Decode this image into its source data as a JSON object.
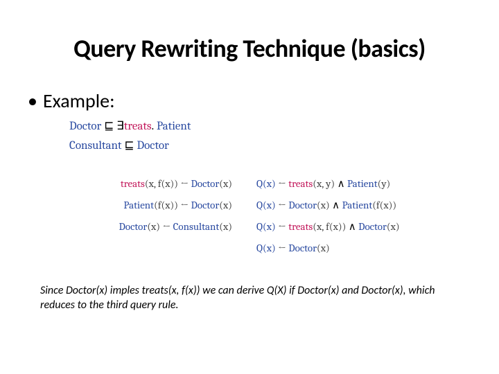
{
  "title": "Query Rewriting Technique (basics)",
  "bullet_label": "Example:",
  "bullet_marker": "•",
  "axioms": {
    "line1": {
      "lhs_concept": "Doctor",
      "sub": "⊑",
      "exists": "∃",
      "role": "treats",
      "dot": ".",
      "rhs_concept": "Patient"
    },
    "line2": {
      "lhs_concept": "Consultant",
      "sub": "⊑",
      "rhs_concept": "Doctor"
    }
  },
  "left_rules": [
    {
      "head_role": "treats",
      "head_args": "(x, f(x))",
      "arrow": "←",
      "body_concept": "Doctor",
      "body_args": "(x)"
    },
    {
      "head_concept": "Patient",
      "head_args": "(f(x))",
      "arrow": "←",
      "body_concept": "Doctor",
      "body_args": "(x)"
    },
    {
      "head_concept": "Doctor",
      "head_args": "(x)",
      "arrow": "←",
      "body_concept": "Consultant",
      "body_args": "(x)"
    }
  ],
  "right_rules": [
    {
      "q": "Q(x)",
      "arrow": "←",
      "p1_role": "treats",
      "p1_args": "(x, y)",
      "conj": "∧",
      "p2_concept": "Patient",
      "p2_args": "(y)"
    },
    {
      "q": "Q(x)",
      "arrow": "←",
      "p1_concept": "Doctor",
      "p1_args": "(x)",
      "conj": "∧",
      "p2_concept": "Patient",
      "p2_args": "(f(x))"
    },
    {
      "q": "Q(x)",
      "arrow": "←",
      "p1_role": "treats",
      "p1_args": "(x, f(x))",
      "conj": "∧",
      "p2_concept": "Doctor",
      "p2_args": "(x)"
    },
    {
      "q": "Q(x)",
      "arrow": "←",
      "p1_concept": "Doctor",
      "p1_args": "(x)"
    }
  ],
  "footnote": "Since Doctor(x) imples treats(x, f(x)) we can derive Q(X) if Doctor(x) and Doctor(x), which reduces to the third query rule."
}
